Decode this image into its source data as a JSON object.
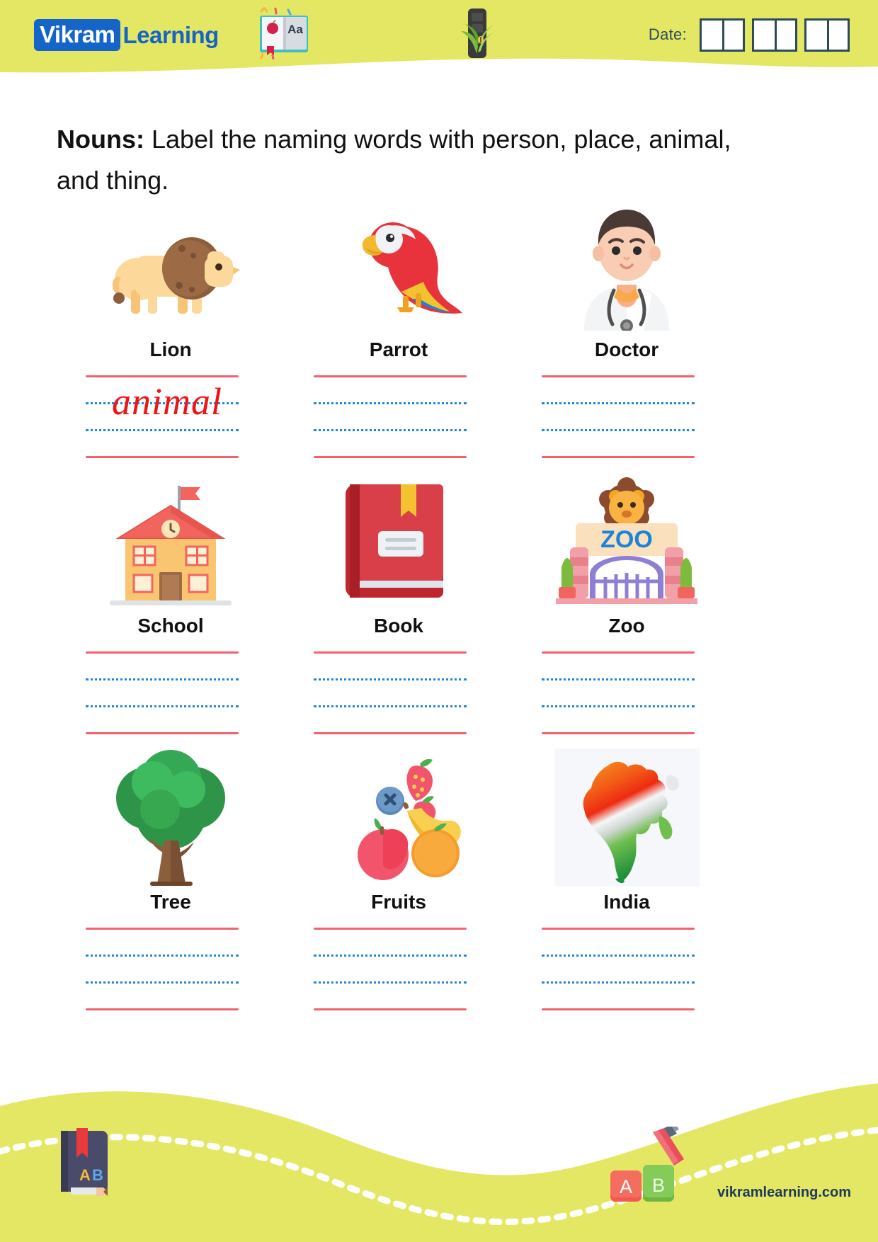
{
  "header": {
    "logo_badge_text": "Vikram",
    "logo_word_text": "Learning",
    "logo_badge_color": "#1565c9",
    "background_color": "#e4e764",
    "date_label": "Date:",
    "date_boxes": [
      "",
      "",
      "",
      "",
      "",
      ""
    ],
    "book_icon_name": "open-book-icon",
    "book_icon_letters": "Aa",
    "plant_icon_name": "plant-in-pot-icon"
  },
  "worksheet": {
    "title_bold": "Nouns:",
    "title_rest": " Label the naming words with person, place, animal, and thing."
  },
  "items": [
    {
      "word": "Lion",
      "icon": "lion-icon",
      "answer": "animal",
      "category": "animal"
    },
    {
      "word": "Parrot",
      "icon": "parrot-icon",
      "answer": "",
      "category": "animal"
    },
    {
      "word": "Doctor",
      "icon": "doctor-icon",
      "answer": "",
      "category": "person"
    },
    {
      "word": "School",
      "icon": "school-icon",
      "answer": "",
      "category": "place"
    },
    {
      "word": "Book",
      "icon": "book-icon",
      "answer": "",
      "category": "thing"
    },
    {
      "word": "Zoo",
      "icon": "zoo-entrance-icon",
      "answer": "",
      "category": "place"
    },
    {
      "word": "Tree",
      "icon": "tree-icon",
      "answer": "",
      "category": "thing"
    },
    {
      "word": "Fruits",
      "icon": "fruits-icon",
      "answer": "",
      "category": "thing"
    },
    {
      "word": "India",
      "icon": "india-map-icon",
      "answer": "",
      "category": "place"
    }
  ],
  "zoo_sign_text": "ZOO",
  "footer": {
    "website": "vikramlearning.com",
    "band_color": "#e4e764",
    "book_icon_name": "closed-book-pencil-icon",
    "book_icon_letters": [
      "A",
      "B"
    ],
    "blocks_icon_name": "ab-blocks-pencil-icon",
    "block_a_letter": "A",
    "block_b_letter": "B",
    "block_a_color": "#f3594f",
    "block_b_color": "#85cb5a"
  },
  "colors": {
    "rule_red": "#f4616b",
    "rule_blue": "#1f86e0",
    "answer_red": "#f01414",
    "accent_yellow": "#e4e764",
    "logo_blue": "#1565c9"
  }
}
